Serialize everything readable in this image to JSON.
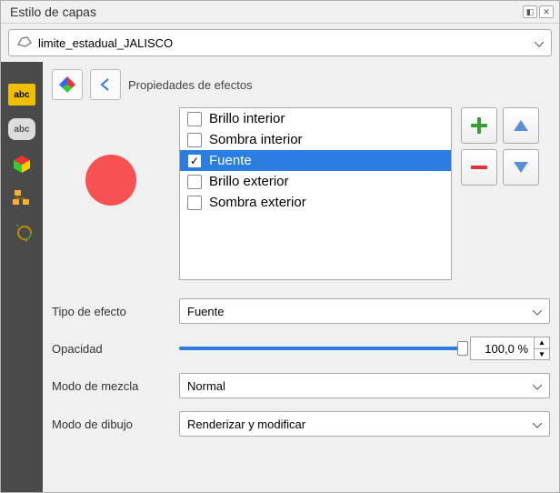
{
  "title": "Estilo de capas",
  "layer_name": "limite_estadual_JALISCO",
  "properties_label": "Propiedades de efectos",
  "effects": [
    {
      "label": "Brillo interior",
      "checked": false,
      "selected": false
    },
    {
      "label": "Sombra interior",
      "checked": false,
      "selected": false
    },
    {
      "label": "Fuente",
      "checked": true,
      "selected": true
    },
    {
      "label": "Brillo exterior",
      "checked": false,
      "selected": false
    },
    {
      "label": "Sombra exterior",
      "checked": false,
      "selected": false
    }
  ],
  "type_field": {
    "label": "Tipo de efecto",
    "value": "Fuente"
  },
  "opacity": {
    "label": "Opacidad",
    "value_pct": 100,
    "display": "100,0 %"
  },
  "blend": {
    "label": "Modo de mezcla",
    "value": "Normal"
  },
  "draw": {
    "label": "Modo de dibujo",
    "value": "Renderizar y modificar"
  }
}
